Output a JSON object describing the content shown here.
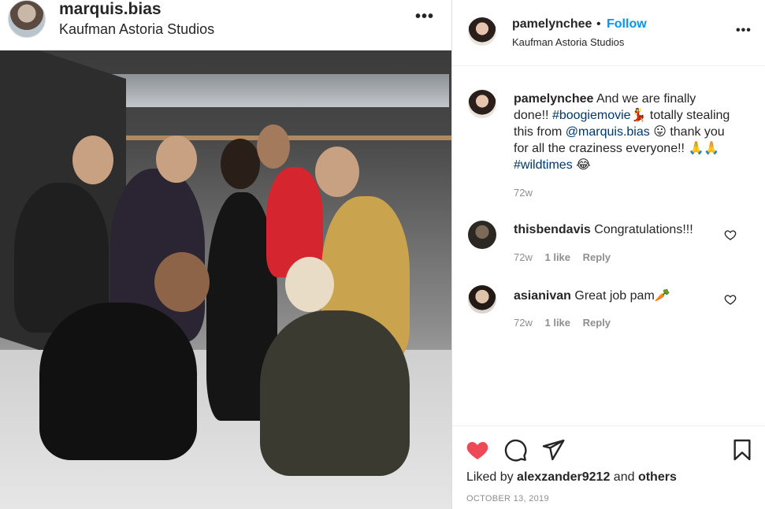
{
  "left_post": {
    "username": "marquis.bias",
    "location": "Kaufman Astoria Studios",
    "more": "•••"
  },
  "right_post": {
    "username": "pamelynchee",
    "separator": "•",
    "follow": "Follow",
    "location": "Kaufman Astoria Studios",
    "more": "•••"
  },
  "caption": {
    "username": "pamelynchee",
    "text_1": " And we are finally done!! ",
    "hashtag_1": "#boogiemovie",
    "emoji_1": "💃",
    "text_2": " totally stealing this from ",
    "mention": "@marquis.bias",
    "emoji_2": " 😛",
    "text_3": " thank you for all the craziness everyone!! ",
    "emoji_3": "🙏🙏",
    "space": " ",
    "hashtag_2": "#wildtimes",
    "emoji_4": " 😂",
    "time": "72w"
  },
  "comments": [
    {
      "username": "thisbendavis",
      "text": " Congratulations!!!",
      "time": "72w",
      "likes": "1 like",
      "reply": "Reply"
    },
    {
      "username": "asianivan",
      "text": " Great job pam",
      "emoji": "🥕",
      "time": "72w",
      "likes": "1 like",
      "reply": "Reply"
    }
  ],
  "likes": {
    "prefix": "Liked by ",
    "user": "alexzander9212",
    "middle": " and ",
    "others": "others"
  },
  "date": "OCTOBER 13, 2019",
  "icons": {
    "like": "heart-filled-icon",
    "comment": "comment-icon",
    "share": "share-icon",
    "save": "bookmark-icon"
  },
  "colors": {
    "like_red": "#ed4956",
    "follow_blue": "#0095f6",
    "tag_blue": "#00376b",
    "muted": "#8e8e8e"
  }
}
